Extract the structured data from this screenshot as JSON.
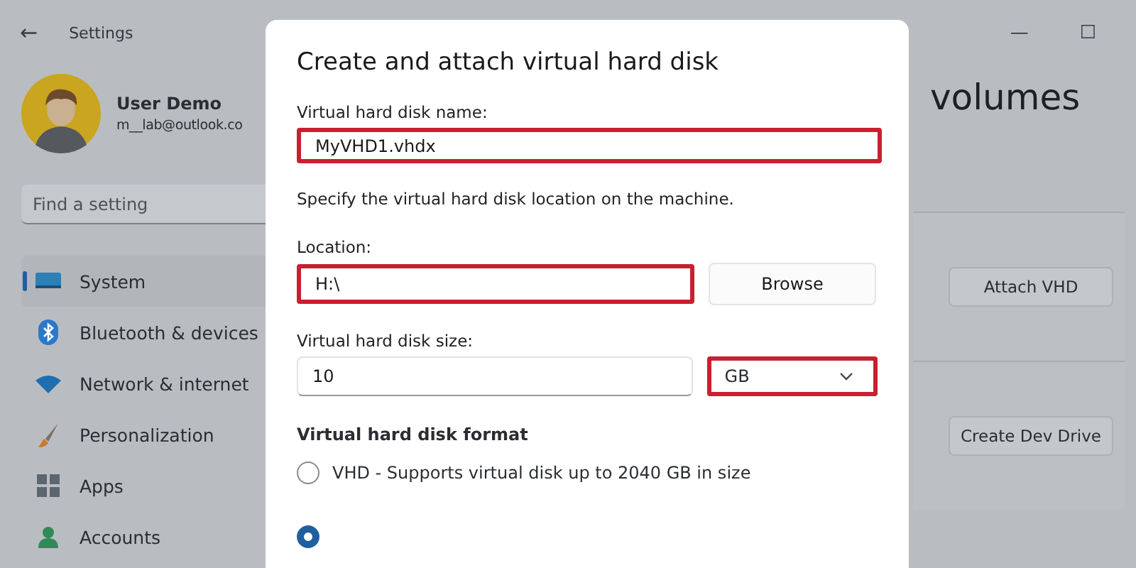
{
  "window": {
    "back": "←",
    "title": "Settings",
    "controls": [
      "—",
      "☐"
    ]
  },
  "user": {
    "name": "User Demo",
    "email": "m__lab@outlook.co"
  },
  "search": {
    "placeholder": "Find a setting"
  },
  "sidebar": {
    "items": [
      {
        "label": "System",
        "kind": "system",
        "selected": true
      },
      {
        "label": "Bluetooth & devices",
        "kind": "bluetooth",
        "selected": false
      },
      {
        "label": "Network & internet",
        "kind": "network",
        "selected": false
      },
      {
        "label": "Personalization",
        "kind": "brush",
        "selected": false
      },
      {
        "label": "Apps",
        "kind": "apps",
        "selected": false
      },
      {
        "label": "Accounts",
        "kind": "accounts",
        "selected": false
      }
    ]
  },
  "page": {
    "heading": "volumes",
    "cards": [
      {
        "button": "Attach VHD"
      },
      {
        "button": "Create Dev Drive"
      }
    ]
  },
  "dialog": {
    "title": "Create and attach virtual hard disk",
    "name_field": {
      "label": "Virtual hard disk name:",
      "value": "MyVHD1.vhdx",
      "highlighted": true
    },
    "location_hint": "Specify the virtual hard disk location on the machine.",
    "location_field": {
      "label": "Location:",
      "value": "H:\\",
      "highlighted": true
    },
    "browse_button": "Browse",
    "size_field": {
      "label": "Virtual hard disk size:",
      "value": "10",
      "highlighted": false
    },
    "unit_dropdown": {
      "value": "GB",
      "highlighted": true
    },
    "format": {
      "heading": "Virtual hard disk format",
      "options": [
        {
          "label": "VHD - Supports virtual disk up to 2040 GB in size",
          "selected": false
        },
        {
          "selected": true
        }
      ]
    }
  }
}
